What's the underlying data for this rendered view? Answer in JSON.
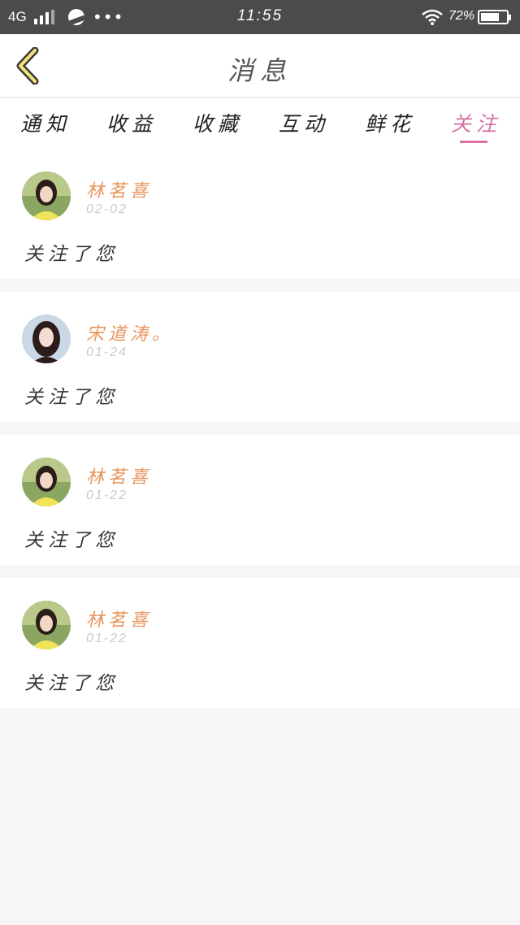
{
  "status_bar": {
    "network": "4G",
    "time": "11:55",
    "battery_percent": "72%",
    "battery_level": 0.72
  },
  "nav": {
    "title": "消息",
    "back_icon": "chevron-left-icon"
  },
  "tabs": [
    {
      "label": "通知",
      "active": false
    },
    {
      "label": "收益",
      "active": false
    },
    {
      "label": "收藏",
      "active": false
    },
    {
      "label": "互动",
      "active": false
    },
    {
      "label": "鲜花",
      "active": false
    },
    {
      "label": "关注",
      "active": true
    }
  ],
  "colors": {
    "accent": "#d872a6",
    "name": "#e8955d",
    "date": "#c9c9c9"
  },
  "messages": [
    {
      "name": "林茗喜",
      "date": "02-02",
      "text": "关注了您",
      "avatar": "avatar-yellow"
    },
    {
      "name": "宋道涛。",
      "date": "01-24",
      "text": "关注了您",
      "avatar": "avatar-dark-hair"
    },
    {
      "name": "林茗喜",
      "date": "01-22",
      "text": "关注了您",
      "avatar": "avatar-yellow"
    },
    {
      "name": "林茗喜",
      "date": "01-22",
      "text": "关注了您",
      "avatar": "avatar-yellow"
    }
  ]
}
